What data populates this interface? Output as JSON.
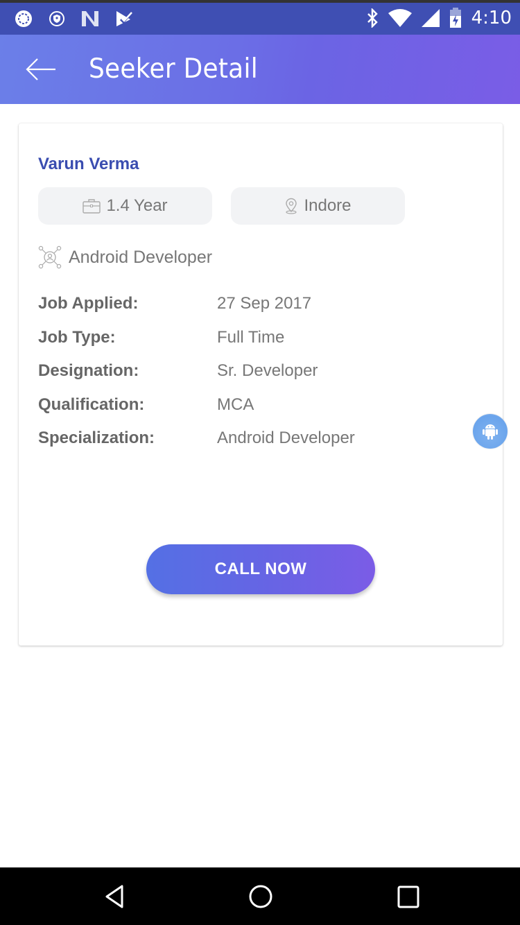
{
  "status_bar": {
    "time": "4:10",
    "left_icons": [
      "sync-icon",
      "vpn-shield-icon",
      "n-app-icon",
      "check-app-icon"
    ],
    "right_icons": [
      "bluetooth-icon",
      "wifi-icon",
      "signal-icon",
      "battery-charging-icon"
    ]
  },
  "app_bar": {
    "title": "Seeker Detail",
    "back_icon": "arrow-left-icon"
  },
  "seeker": {
    "name": "Varun Verma",
    "experience": "1.4 Year",
    "location": "Indore",
    "role": "Android Developer",
    "details": [
      {
        "label": "Job Applied:",
        "value": "27 Sep 2017"
      },
      {
        "label": "Job Type:",
        "value": "Full Time"
      },
      {
        "label": "Designation:",
        "value": "Sr. Developer"
      },
      {
        "label": "Qualification:",
        "value": "MCA"
      },
      {
        "label": "Specialization:",
        "value": "Android Developer"
      }
    ]
  },
  "actions": {
    "call_label": "CALL NOW"
  },
  "colors": {
    "accent_start": "#5470e4",
    "accent_end": "#7b5ce6",
    "name_color": "#3a4db0",
    "status_bar": "#3f4fb3"
  },
  "nav_bar": {
    "buttons": [
      "back-triangle-icon",
      "home-circle-icon",
      "recents-square-icon"
    ]
  }
}
